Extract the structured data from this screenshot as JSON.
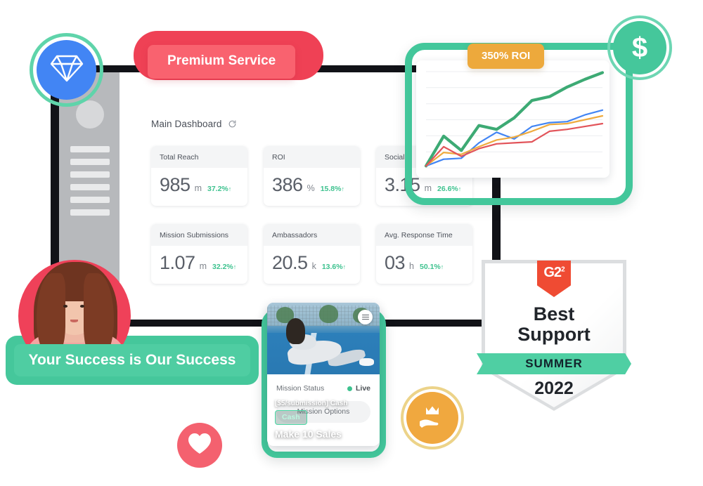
{
  "dashboard": {
    "title": "Main Dashboard",
    "refresh_icon": "refresh-icon",
    "metrics_row1": [
      {
        "label": "Total Reach",
        "value": "985",
        "unit": "m",
        "delta": "37.2%",
        "arrow": "↑"
      },
      {
        "label": "ROI",
        "value": "386",
        "unit": "%",
        "delta": "15.8%",
        "arrow": "↑"
      },
      {
        "label": "Social B",
        "value": "3.15",
        "unit": "m",
        "delta": "26.6%",
        "arrow": "↑"
      }
    ],
    "metrics_row2": [
      {
        "label": "Mission Submissions",
        "value": "1.07",
        "unit": "m",
        "delta": "32.2%",
        "arrow": "↑"
      },
      {
        "label": "Ambassadors",
        "value": "20.5",
        "unit": "k",
        "delta": "13.6%",
        "arrow": "↑"
      },
      {
        "label": "Avg. Response Time",
        "value": "03",
        "unit": "h",
        "delta": "50.1%",
        "arrow": "↑"
      }
    ]
  },
  "roi_pill": {
    "label": "350% ROI",
    "color": "#eda93c"
  },
  "chart_data": {
    "type": "line",
    "title": "",
    "xlabel": "",
    "ylabel": "",
    "grid": true,
    "legend_position": "none",
    "x": [
      0,
      1,
      2,
      3,
      4,
      5,
      6,
      7,
      8,
      9,
      10
    ],
    "ylim": [
      0,
      100
    ],
    "series": [
      {
        "name": "Green",
        "color": "#3daa74",
        "values": [
          2,
          33,
          18,
          44,
          40,
          52,
          70,
          74,
          84,
          92,
          99
        ]
      },
      {
        "name": "Blue",
        "color": "#4285f4",
        "values": [
          2,
          9,
          10,
          26,
          37,
          30,
          43,
          47,
          48,
          55,
          60
        ]
      },
      {
        "name": "Orange",
        "color": "#efab3f",
        "values": [
          2,
          16,
          14,
          22,
          29,
          32,
          38,
          45,
          46,
          50,
          54
        ]
      },
      {
        "name": "Red",
        "color": "#e2545a",
        "values": [
          2,
          22,
          12,
          20,
          25,
          26,
          27,
          38,
          40,
          43,
          46
        ]
      }
    ]
  },
  "mission": {
    "submission_label": "[$5/submission] Cash",
    "badge": "Cash",
    "title": "Make 10 Sales",
    "status_label": "Mission Status",
    "status_value": "Live",
    "options_label": "Mission Options",
    "menu_icon": "hamburger-menu-icon"
  },
  "pills": {
    "premium": "Premium Service",
    "success": "Your Success is Our Success"
  },
  "badges": {
    "diamond": {
      "icon": "diamond-icon",
      "color": "#4285f4"
    },
    "dollar": {
      "icon": "dollar-icon",
      "symbol": "$",
      "color": "#45c79b"
    },
    "heart": {
      "icon": "heart-icon",
      "color": "#f4616f"
    },
    "crown": {
      "icon": "hand-holding-crown-icon",
      "color": "#f0a83f"
    }
  },
  "g2_badge": {
    "logo": "G2",
    "logo_sup": "2",
    "title_line1": "Best",
    "title_line2": "Support",
    "season": "SUMMER",
    "year": "2022"
  },
  "avatar": {
    "name": "ambassador-portrait"
  }
}
